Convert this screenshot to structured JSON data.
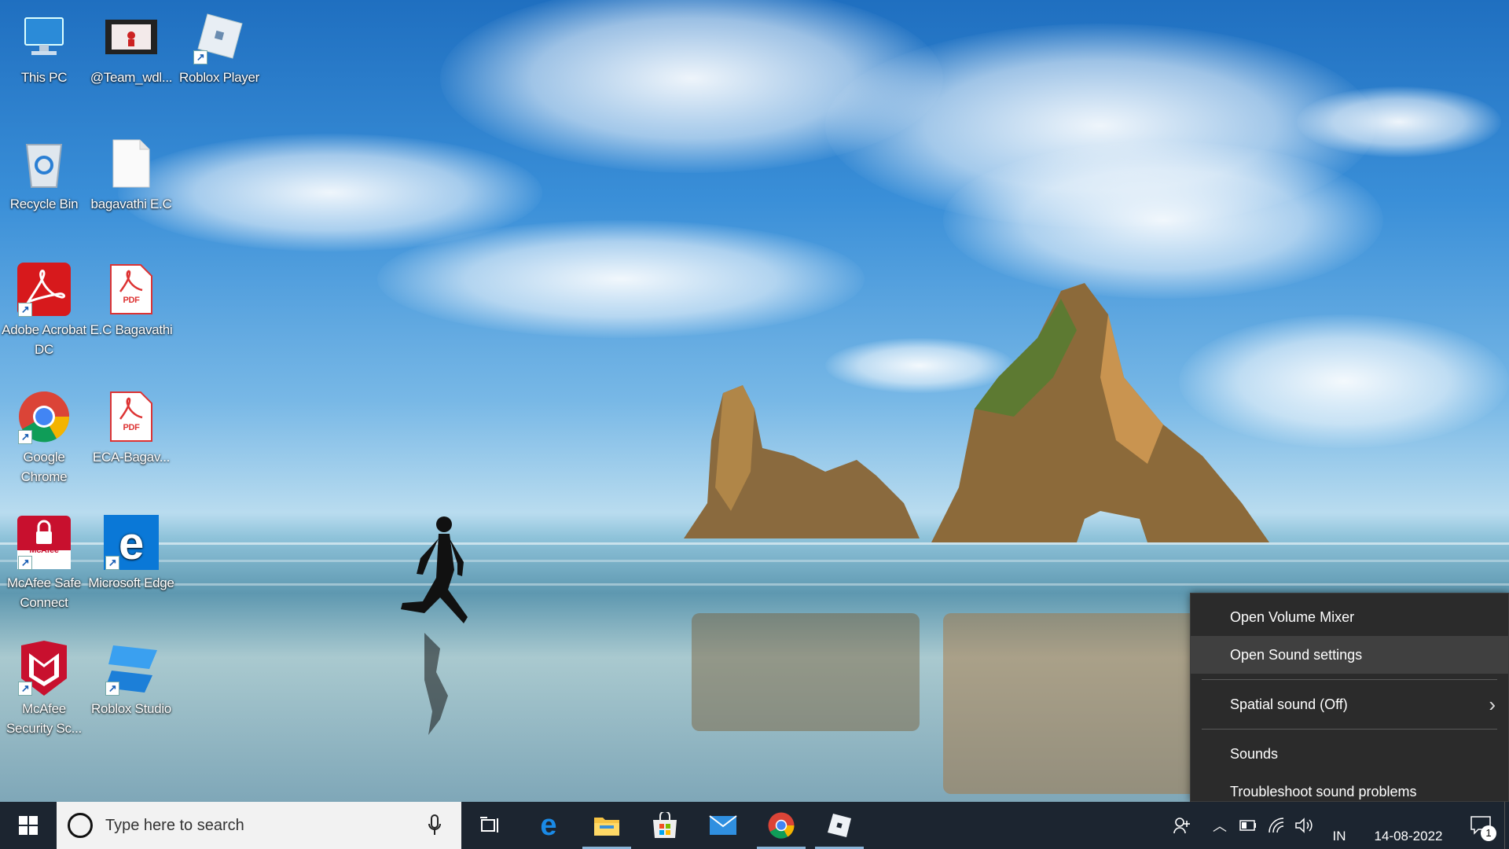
{
  "desktop_icons": [
    {
      "label": "This PC",
      "icon": "computer-icon"
    },
    {
      "label": "@Team_wdl...",
      "icon": "video-file-icon"
    },
    {
      "label": "Roblox Player",
      "icon": "roblox-icon"
    },
    {
      "label": "Recycle Bin",
      "icon": "recycle-bin-icon"
    },
    {
      "label": "bagavathi E.C",
      "icon": "blank-file-icon"
    },
    {
      "label": "Adobe Acrobat DC",
      "icon": "acrobat-icon"
    },
    {
      "label": "E.C Bagavathi",
      "icon": "pdf-file-icon"
    },
    {
      "label": "Google Chrome",
      "icon": "chrome-icon"
    },
    {
      "label": "ECA-Bagav...",
      "icon": "pdf-file-icon"
    },
    {
      "label": "McAfee Safe Connect",
      "icon": "mcafee-safe-connect-icon"
    },
    {
      "label": "Microsoft Edge",
      "icon": "edge-icon"
    },
    {
      "label": "McAfee Security Sc...",
      "icon": "mcafee-icon"
    },
    {
      "label": "Roblox Studio",
      "icon": "roblox-studio-icon"
    }
  ],
  "pdf_badge": "PDF",
  "mcafee_badge": "McAfee",
  "context_menu": {
    "items": [
      {
        "label": "Open Volume Mixer"
      },
      {
        "label": "Open Sound settings",
        "highlighted": true
      },
      {
        "label": "Spatial sound (Off)",
        "submenu": true
      },
      {
        "label": "Sounds"
      },
      {
        "label": "Troubleshoot sound problems"
      }
    ]
  },
  "taskbar": {
    "search_placeholder": "Type here to search",
    "pinned": [
      "task-view-icon",
      "edge-icon",
      "file-explorer-icon",
      "microsoft-store-icon",
      "mail-icon",
      "chrome-icon",
      "roblox-icon"
    ],
    "tray": {
      "language": "IN",
      "date": "14-08-2022",
      "notification_count": "1"
    }
  },
  "colors": {
    "taskbar_bg": "#1c2530",
    "menu_bg": "#2b2b2b",
    "menu_highlight": "#404040"
  }
}
